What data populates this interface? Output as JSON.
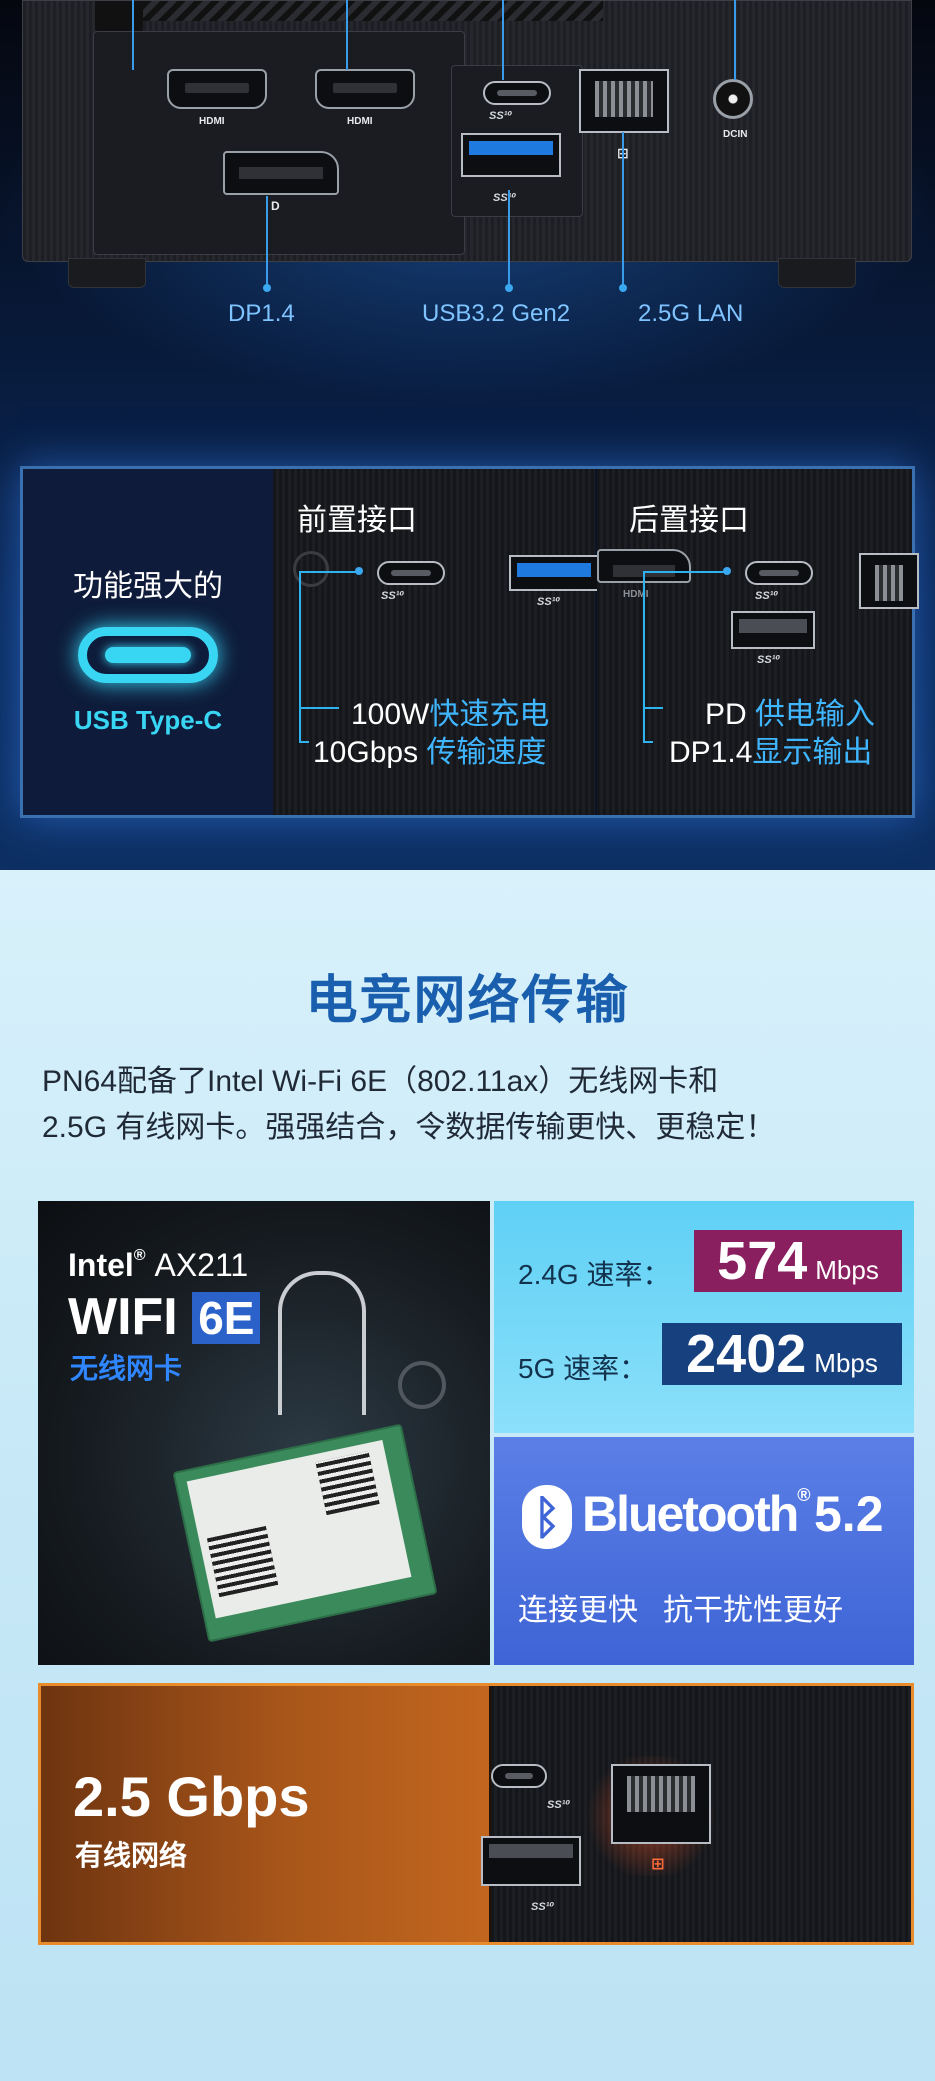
{
  "ports": {
    "hdmi1": "HDMI",
    "hdmi2": "HDMI",
    "dcin": "DCIN",
    "usbc_tag": "SS⁴ᐩ",
    "usba_tag": "SS¹⁰",
    "labels": {
      "dp": "DP1.4",
      "usb": "USB3.2 Gen2",
      "lan": "2.5G LAN"
    }
  },
  "usbc_panel": {
    "tagline": "功能强大的",
    "badge": "USB Type-C",
    "front": {
      "title": "前置接口",
      "line1_plain": "100W",
      "line1_hl": "快速充电",
      "line2_plain": "10Gbps ",
      "line2_hl": "传输速度"
    },
    "rear": {
      "title": "后置接口",
      "line1_plain": "PD ",
      "line1_hl": "供电输入",
      "line2_plain": "DP1.4",
      "line2_hl": "显示输出",
      "hdmi_tag": "HDMI"
    },
    "ss_tag": "SS¹⁰"
  },
  "network": {
    "heading": "电竞网络传输",
    "para_line1": "PN64配备了Intel Wi-Fi 6E（802.11ax）无线网卡和",
    "para_line2": "2.5G 有线网卡。强强结合，令数据传输更快、更稳定！",
    "wifi": {
      "brand": "Intel",
      "reg": "®",
      "model": "AX211",
      "wifi_text": "WIFI",
      "six_e": "6E",
      "subtitle": "无线网卡"
    },
    "rates": [
      {
        "label": "2.4G 速率：",
        "value": "574",
        "unit": "Mbps",
        "color": "#8a1f5f"
      },
      {
        "label": "5G 速率：",
        "value": "2402",
        "unit": "Mbps",
        "color": "#17407e"
      }
    ],
    "bluetooth": {
      "word": "Bluetooth",
      "reg": "®",
      "version": "5.2",
      "caption": "连接更快   抗干扰性更好"
    },
    "lan": {
      "speed": "2.5 Gbps",
      "caption": "有线网络"
    }
  }
}
